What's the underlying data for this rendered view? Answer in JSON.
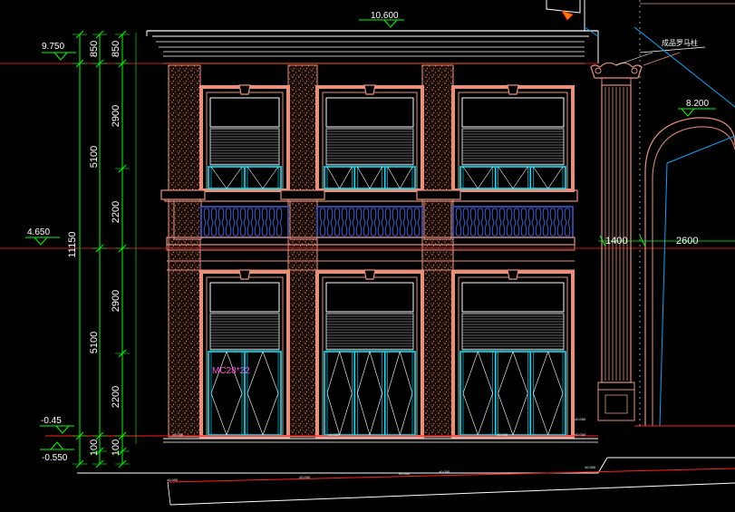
{
  "elevations": {
    "top": "10.600",
    "cornice": "9.750",
    "mid": "4.650",
    "arch": "8.200",
    "floor": "-0.45",
    "ground": "-0.550"
  },
  "dimensions": {
    "d850_outer": "850",
    "d850_inner": "850",
    "d2900_upper": "2900",
    "d2200_upper": "2200",
    "d5100_upper": "5100",
    "d11150": "11150",
    "d2900_lower": "2900",
    "d2200_lower": "2200",
    "d5100_lower": "5100",
    "d100_outer": "100",
    "d100_inner": "100",
    "d1400": "1400",
    "d2600": "2600"
  },
  "labels": {
    "roman_column": "成品罗马柱",
    "window_tag": "MC28*22"
  },
  "colors": {
    "background": "#000000",
    "wall_salmon": "#e8907a",
    "glass_cyan": "#00e5ff",
    "balustrade_blue": "#3a5fd0",
    "dimension_green": "#00ff00",
    "red_line": "#ff2020",
    "yellow_line": "#ffff00",
    "white_line": "#ffffff"
  }
}
